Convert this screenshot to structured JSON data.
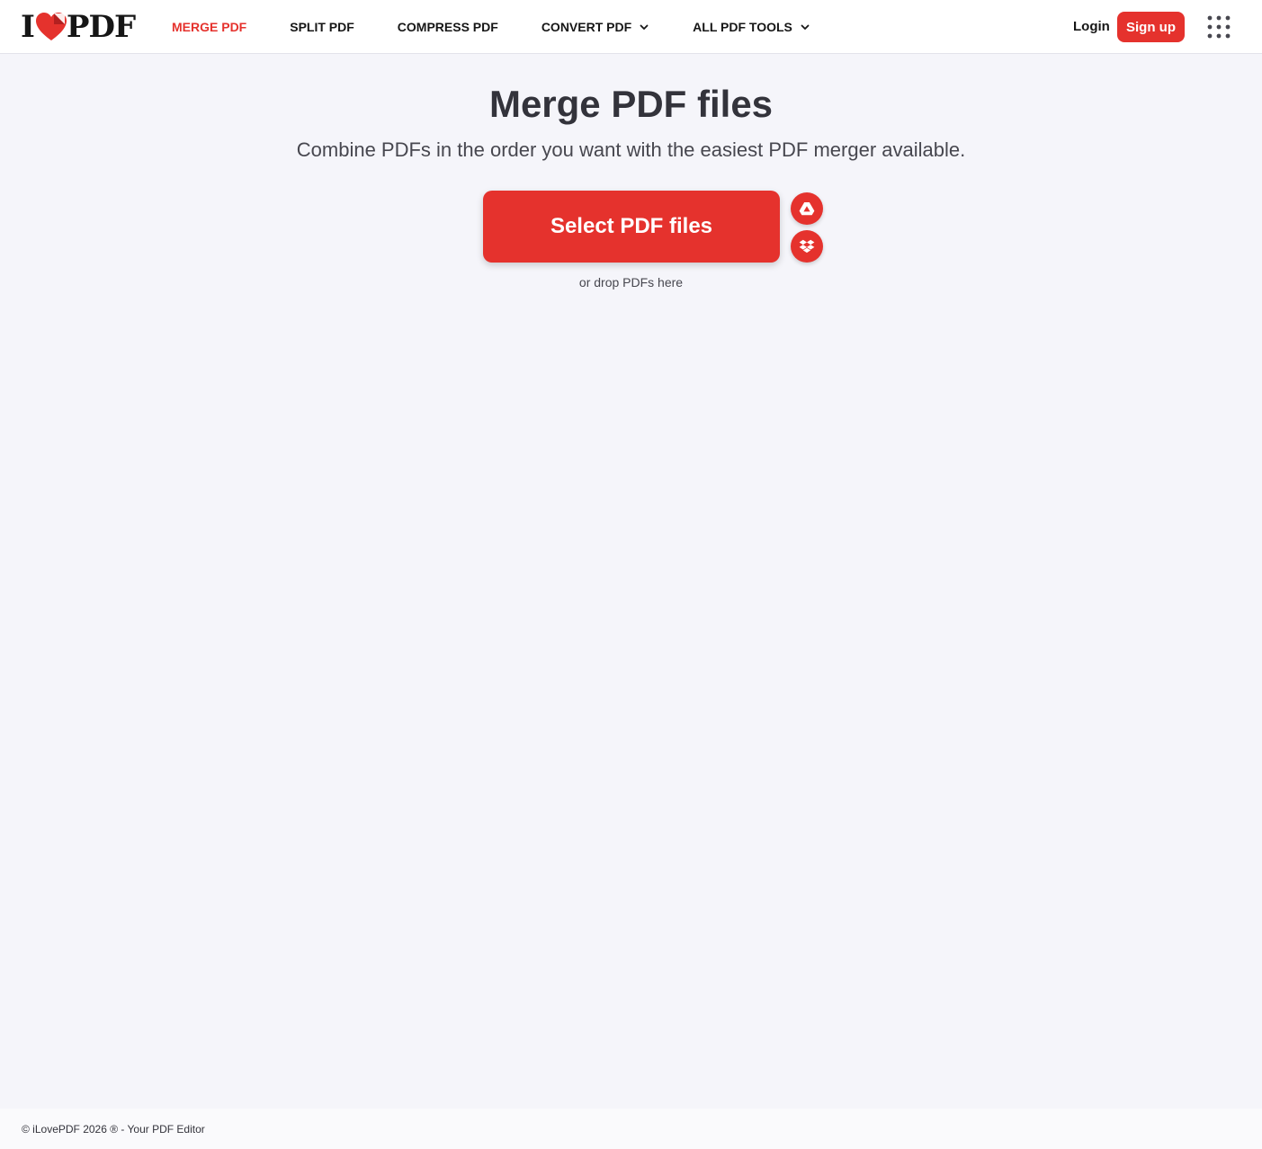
{
  "brand": {
    "logo_left": "I",
    "logo_right": "PDF",
    "accent_color": "#e5322d"
  },
  "nav": {
    "items": [
      {
        "label": "MERGE PDF",
        "active": true
      },
      {
        "label": "SPLIT PDF"
      },
      {
        "label": "COMPRESS PDF"
      },
      {
        "label": "CONVERT PDF",
        "dropdown": true
      },
      {
        "label": "ALL PDF TOOLS",
        "dropdown": true
      }
    ]
  },
  "account": {
    "login_label": "Login",
    "signup_label": "Sign up"
  },
  "icons": {
    "apps": "grid-dots-icon",
    "google_drive": "google-drive-icon",
    "dropbox": "dropbox-icon",
    "chevron": "chevron-down-icon"
  },
  "main": {
    "title": "Merge PDF files",
    "subtitle": "Combine PDFs in the order you want with the easiest PDF merger available.",
    "select_label": "Select PDF files",
    "drop_hint": "or drop PDFs here"
  },
  "footer": {
    "text": "© iLovePDF 2026 ® - Your PDF Editor"
  }
}
